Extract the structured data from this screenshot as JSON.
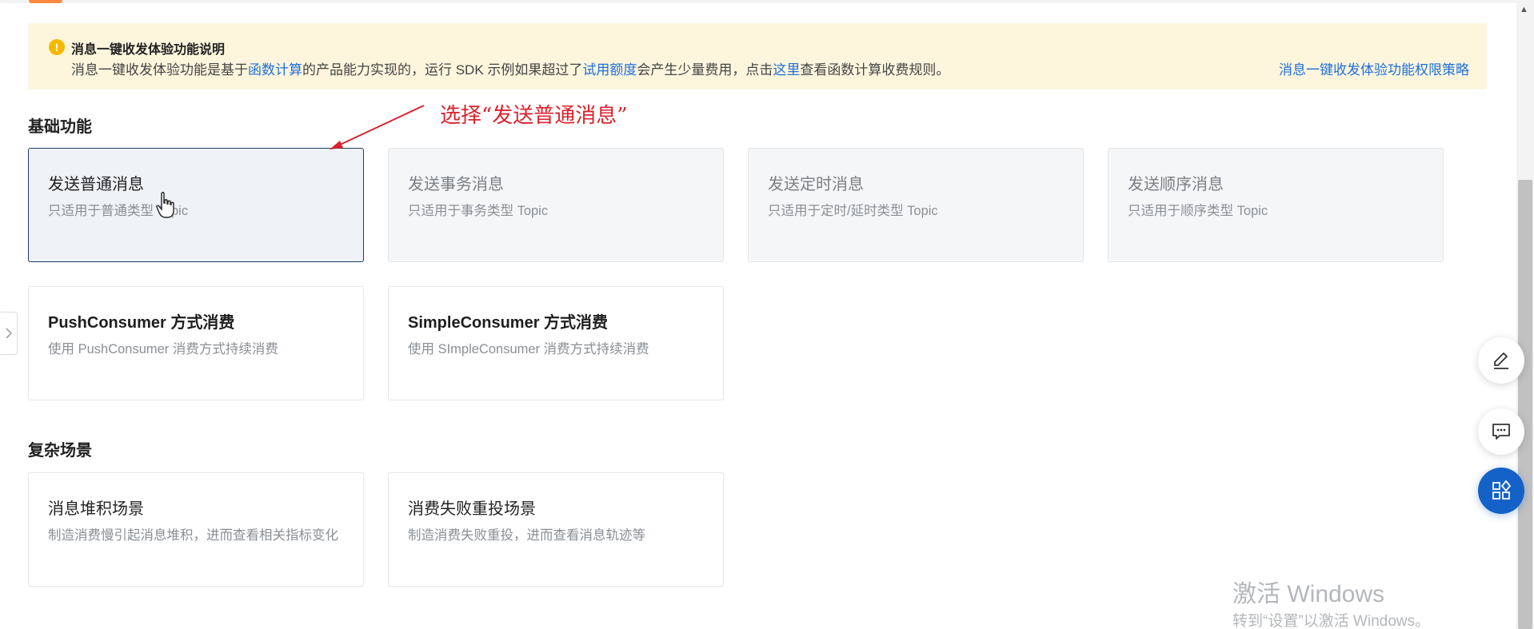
{
  "notice": {
    "title": "消息一键收发体验功能说明",
    "body_1": "消息一键收发体验功能是基于",
    "link_fc": "函数计算",
    "body_2": "的产品能力实现的，运行 SDK 示例如果超过了",
    "link_quota": "试用额度",
    "body_3": "会产生少量费用，点击",
    "link_here": "这里",
    "body_4": "查看函数计算收费规则。",
    "right_link": "消息一键收发体验功能权限策略"
  },
  "annotation": {
    "text": "选择“发送普通消息”",
    "color": "#d9232e"
  },
  "sections": {
    "basic": {
      "title": "基础功能",
      "cards": [
        {
          "title": "发送普通消息",
          "desc": "只适用于普通类型 Topic"
        },
        {
          "title": "发送事务消息",
          "desc": "只适用于事务类型 Topic"
        },
        {
          "title": "发送定时消息",
          "desc": "只适用于定时/延时类型 Topic"
        },
        {
          "title": "发送顺序消息",
          "desc": "只适用于顺序类型 Topic"
        },
        {
          "title": "PushConsumer 方式消费",
          "desc": "使用 PushConsumer 消费方式持续消费"
        },
        {
          "title": "SimpleConsumer 方式消费",
          "desc": "使用 SImpleConsumer 消费方式持续消费"
        }
      ]
    },
    "complex": {
      "title": "复杂场景",
      "cards": [
        {
          "title": "消息堆积场景",
          "desc": "制造消费慢引起消息堆积，进而查看相关指标变化"
        },
        {
          "title": "消费失败重投场景",
          "desc": "制造消费失败重投，进而查看消息轨迹等"
        }
      ]
    }
  },
  "icons": {
    "notice": "warning-icon",
    "side_tab": "chevron-right-icon",
    "edit": "edit-icon",
    "feedback": "feedback-icon",
    "apps": "apps-icon",
    "cursor": "hand-cursor-icon"
  },
  "colors": {
    "accent": "#1f6fd8",
    "selected_border": "#1a3a66",
    "primary_button": "#1462c8",
    "notice_bg": "#fdf6dd"
  },
  "watermark": {
    "title": "激活 Windows",
    "sub": "转到“设置”以激活 Windows。"
  }
}
